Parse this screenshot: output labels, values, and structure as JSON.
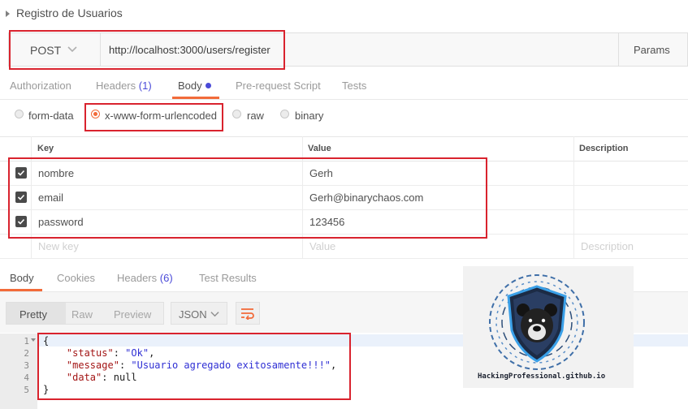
{
  "collection": {
    "title": "Registro de Usuarios"
  },
  "request": {
    "method": "POST",
    "url": "http://localhost:3000/users/register",
    "params_label": "Params"
  },
  "request_tabs": {
    "authorization": "Authorization",
    "headers": "Headers",
    "headers_count": "(1)",
    "body": "Body",
    "prerequest": "Pre-request Script",
    "tests": "Tests"
  },
  "body_types": [
    {
      "label": "form-data",
      "selected": false
    },
    {
      "label": "x-www-form-urlencoded",
      "selected": true
    },
    {
      "label": "raw",
      "selected": false
    },
    {
      "label": "binary",
      "selected": false
    }
  ],
  "params_table": {
    "headers": {
      "key": "Key",
      "value": "Value",
      "description": "Description"
    },
    "rows": [
      {
        "key": "nombre",
        "value": "Gerh",
        "checked": true
      },
      {
        "key": "email",
        "value": "Gerh@binarychaos.com",
        "checked": true
      },
      {
        "key": "password",
        "value": "123456",
        "checked": true
      }
    ],
    "new_row": {
      "key_placeholder": "New key",
      "value_placeholder": "Value",
      "description_placeholder": "Description"
    }
  },
  "response_tabs": {
    "body": "Body",
    "cookies": "Cookies",
    "headers": "Headers",
    "headers_count": "(6)",
    "test_results": "Test Results"
  },
  "response_view": {
    "modes": [
      "Pretty",
      "Raw",
      "Preview"
    ],
    "active_mode": "Pretty",
    "format": "JSON"
  },
  "response_body": {
    "line_numbers": [
      "1",
      "2",
      "3",
      "4",
      "5"
    ],
    "open_brace": "{",
    "status_key": "\"status\"",
    "status_value": "\"Ok\"",
    "message_key": "\"message\"",
    "message_value": "\"Usuario agregado exitosamente!!!\"",
    "data_key": "\"data\"",
    "data_value": "null",
    "close_brace": "}"
  },
  "watermark": {
    "text": "HackingProfessional.github.io"
  },
  "colors": {
    "accent": "#f26b3a",
    "count": "#4a4ad8",
    "highlight_box": "#d9232e",
    "json_string": "#2f2fd4",
    "json_key": "#a31515"
  }
}
